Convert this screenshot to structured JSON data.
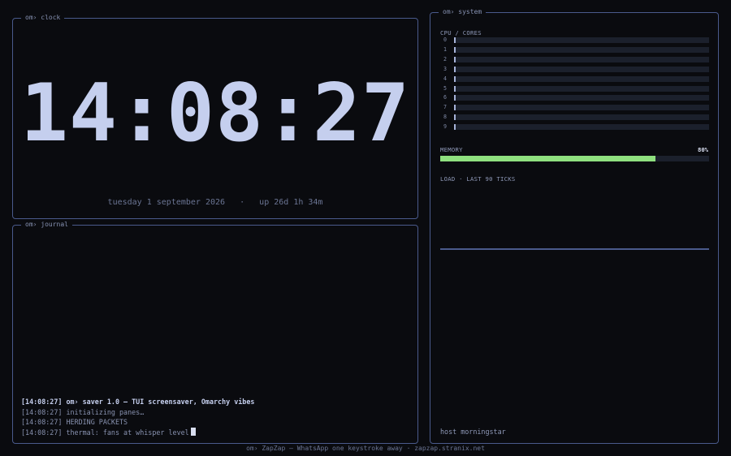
{
  "clock": {
    "title": "om› clock",
    "time": "14:08:27",
    "date_line": "tuesday 1 september 2026   ·   up 26d 1h 34m"
  },
  "journal": {
    "title": "om› journal",
    "lines": [
      "[14:08:27] om› saver 1.0 — TUI screensaver, Omarchy vibes",
      "[14:08:27] initializing panes…",
      "[14:08:27] HERDING PACKETS",
      "[14:08:27] thermal: fans at whisper level"
    ]
  },
  "system": {
    "title": "om› system",
    "cpu_label": "CPU / CORES",
    "cores": [
      {
        "label": "0",
        "load": 0.005
      },
      {
        "label": "1",
        "load": 0.005
      },
      {
        "label": "2",
        "load": 0.005
      },
      {
        "label": "3",
        "load": 0.005
      },
      {
        "label": "4",
        "load": 0.005
      },
      {
        "label": "5",
        "load": 0.005
      },
      {
        "label": "6",
        "load": 0.005
      },
      {
        "label": "7",
        "load": 0.005
      },
      {
        "label": "8",
        "load": 0.005
      },
      {
        "label": "9",
        "load": 0.005
      }
    ],
    "memory_label": "MEMORY",
    "memory_percent_text": "80%",
    "memory_fraction": 0.8,
    "load_label": "LOAD · LAST 90 TICKS",
    "host": "host morningstar"
  },
  "footer": {
    "text": "om› ZapZap — WhatsApp one keystroke away · zapzap.stranix.net"
  },
  "colors": {
    "border": "#4a5a8c",
    "memory_fill": "#8fe07f",
    "core_fill": "#a7b3d8"
  }
}
